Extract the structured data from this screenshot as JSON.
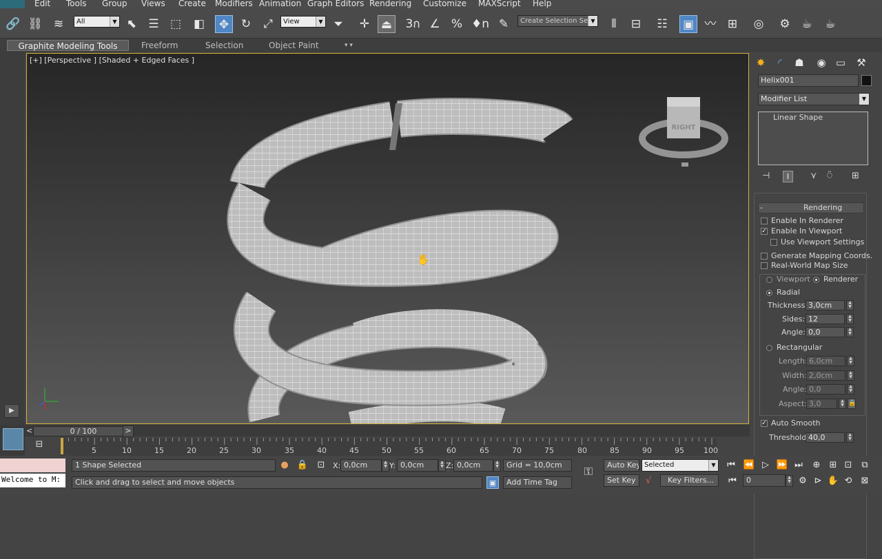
{
  "menu": [
    "Edit",
    "Tools",
    "Group",
    "Views",
    "Create",
    "Modifiers",
    "Animation",
    "Graph Editors",
    "Rendering",
    "Customize",
    "MAXScript",
    "Help"
  ],
  "toolbar": {
    "filter_value": "All",
    "refcoord_value": "View",
    "named_selection_placeholder": "Create Selection Se",
    "snap_labels": {
      "snap3": "3",
      "snap_angle": "∠",
      "snap_percent": "%",
      "snap_spinner": "n"
    }
  },
  "ribbon": {
    "tabs": [
      "Graphite Modeling Tools",
      "Freeform",
      "Selection",
      "Object Paint"
    ],
    "more": "▾ ▾"
  },
  "viewport": {
    "label": "[+] [Perspective ] [Shaded + Edged Faces ]",
    "viewcube_face": "RIGHT"
  },
  "command_panel": {
    "object_name": "Helix001",
    "modifier_list": "Modifier List",
    "stack_items": [
      "Linear Shape"
    ],
    "rollout_title": "Rendering",
    "rollout_minus": "-",
    "enable_in_renderer": "Enable In Renderer",
    "enable_in_viewport": "Enable In Viewport",
    "use_viewport_settings": "Use Viewport Settings",
    "generate_mapping": "Generate Mapping Coords.",
    "real_world_map": "Real-World Map Size",
    "viewport_radio": "Viewport",
    "renderer_radio": "Renderer",
    "radial": "Radial",
    "thickness_label": "Thickness:",
    "thickness_value": "3,0cm",
    "sides_label": "Sides:",
    "sides_value": "12",
    "angle_label": "Angle:",
    "angle_value": "0,0",
    "rectangular": "Rectangular",
    "length_label": "Length:",
    "length_value": "6,0cm",
    "width_label": "Width:",
    "width_value": "2,0cm",
    "rect_angle_label": "Angle:",
    "rect_angle_value": "0,0",
    "aspect_label": "Aspect:",
    "aspect_value": "3,0",
    "auto_smooth": "Auto Smooth",
    "threshold_label": "Threshold:",
    "threshold_value": "40,0",
    "checked": {
      "enable_in_renderer": false,
      "enable_in_viewport": true,
      "use_viewport_settings": false,
      "generate_mapping": false,
      "real_world_map": false,
      "auto_smooth": true
    }
  },
  "timeline": {
    "slider_label": "0 / 100",
    "ticks": [
      "5",
      "10",
      "15",
      "20",
      "25",
      "30",
      "35",
      "40",
      "45",
      "50",
      "55",
      "60",
      "65",
      "70",
      "75",
      "80",
      "85",
      "90",
      "95",
      "100"
    ],
    "prev": "<",
    "next": ">"
  },
  "statusbar": {
    "maxscript": "Welcome to M:",
    "selection_info": "1 Shape Selected",
    "prompt": "Click and drag to select and move objects",
    "x_label": "X:",
    "x_value": "0,0cm",
    "y_label": "Y:",
    "y_value": "0,0cm",
    "z_label": "Z:",
    "z_value": "0,0cm",
    "grid": "Grid = 10,0cm",
    "add_time_tag": "Add Time Tag",
    "auto_key": "Auto Key",
    "set_key": "Set Key",
    "selected_value": "Selected",
    "key_filters": "Key Filters...",
    "frame_value": "0"
  }
}
